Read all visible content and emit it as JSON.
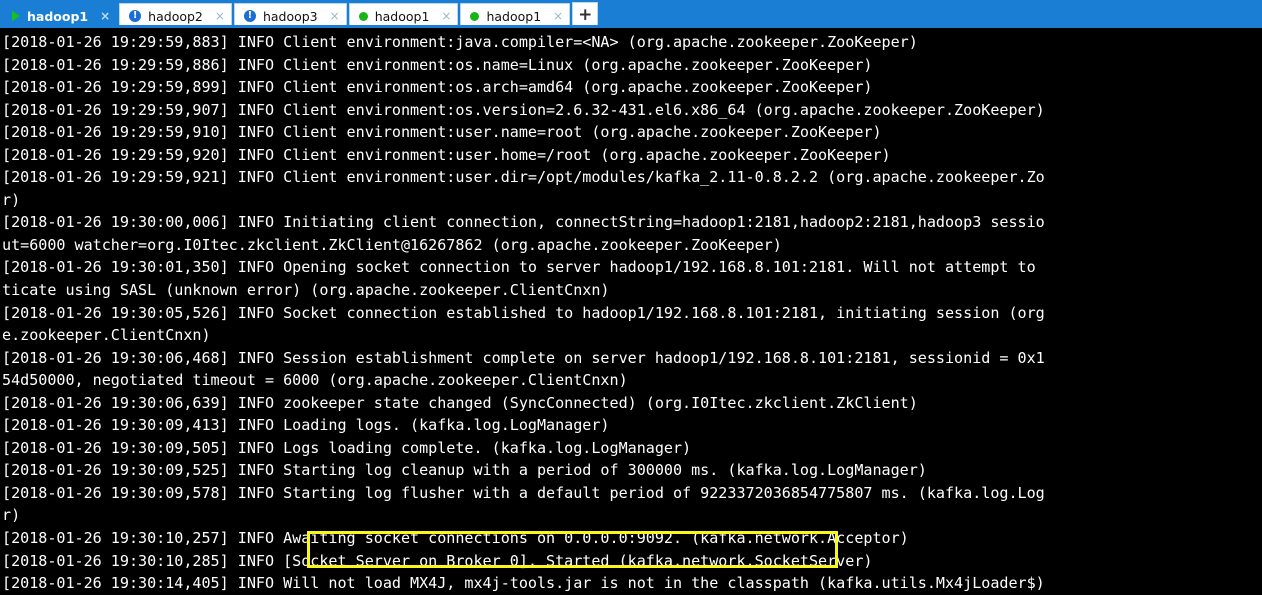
{
  "window": {
    "accent_color": "#1a7fd4",
    "terminal_bg": "#000000",
    "terminal_fg": "#ffffff",
    "highlight_color": "#f7f71a"
  },
  "tabbar": {
    "new_tab_label": "+",
    "close_label": "×",
    "tabs": [
      {
        "label": "hadoop1",
        "icon": "play-icon",
        "status": "running",
        "active": true
      },
      {
        "label": "hadoop2",
        "icon": "alert-circle-icon",
        "status": "alert",
        "active": false
      },
      {
        "label": "hadoop3",
        "icon": "alert-circle-icon",
        "status": "alert",
        "active": false
      },
      {
        "label": "hadoop1",
        "icon": "status-dot-icon",
        "status": "connected",
        "active": false
      },
      {
        "label": "hadoop1",
        "icon": "status-dot-icon",
        "status": "connected",
        "active": false
      }
    ]
  },
  "terminal": {
    "highlighted_text": "INFO Awaiting socket connections on 0.0.0.0:9092.",
    "lines": [
      "[2018-01-26 19:29:59,883] INFO Client environment:java.compiler=<NA> (org.apache.zookeeper.ZooKeeper)",
      "[2018-01-26 19:29:59,886] INFO Client environment:os.name=Linux (org.apache.zookeeper.ZooKeeper)",
      "[2018-01-26 19:29:59,899] INFO Client environment:os.arch=amd64 (org.apache.zookeeper.ZooKeeper)",
      "[2018-01-26 19:29:59,907] INFO Client environment:os.version=2.6.32-431.el6.x86_64 (org.apache.zookeeper.ZooKeeper)",
      "[2018-01-26 19:29:59,910] INFO Client environment:user.name=root (org.apache.zookeeper.ZooKeeper)",
      "[2018-01-26 19:29:59,920] INFO Client environment:user.home=/root (org.apache.zookeeper.ZooKeeper)",
      "[2018-01-26 19:29:59,921] INFO Client environment:user.dir=/opt/modules/kafka_2.11-0.8.2.2 (org.apache.zookeeper.Zo",
      "r)",
      "[2018-01-26 19:30:00,006] INFO Initiating client connection, connectString=hadoop1:2181,hadoop2:2181,hadoop3 sessio",
      "ut=6000 watcher=org.I0Itec.zkclient.ZkClient@16267862 (org.apache.zookeeper.ZooKeeper)",
      "[2018-01-26 19:30:01,350] INFO Opening socket connection to server hadoop1/192.168.8.101:2181. Will not attempt to ",
      "ticate using SASL (unknown error) (org.apache.zookeeper.ClientCnxn)",
      "[2018-01-26 19:30:05,526] INFO Socket connection established to hadoop1/192.168.8.101:2181, initiating session (org",
      "e.zookeeper.ClientCnxn)",
      "[2018-01-26 19:30:06,468] INFO Session establishment complete on server hadoop1/192.168.8.101:2181, sessionid = 0x1",
      "54d50000, negotiated timeout = 6000 (org.apache.zookeeper.ClientCnxn)",
      "[2018-01-26 19:30:06,639] INFO zookeeper state changed (SyncConnected) (org.I0Itec.zkclient.ZkClient)",
      "[2018-01-26 19:30:09,413] INFO Loading logs. (kafka.log.LogManager)",
      "[2018-01-26 19:30:09,505] INFO Logs loading complete. (kafka.log.LogManager)",
      "[2018-01-26 19:30:09,525] INFO Starting log cleanup with a period of 300000 ms. (kafka.log.LogManager)",
      "[2018-01-26 19:30:09,578] INFO Starting log flusher with a default period of 9223372036854775807 ms. (kafka.log.Log",
      "r)",
      "[2018-01-26 19:30:10,257] INFO Awaiting socket connections on 0.0.0.0:9092. (kafka.network.Acceptor)",
      "[2018-01-26 19:30:10,285] INFO [Socket Server on Broker 0], Started (kafka.network.SocketServer)",
      "[2018-01-26 19:30:14,405] INFO Will not load MX4J, mx4j-tools.jar is not in the classpath (kafka.utils.Mx4jLoader$)"
    ]
  }
}
